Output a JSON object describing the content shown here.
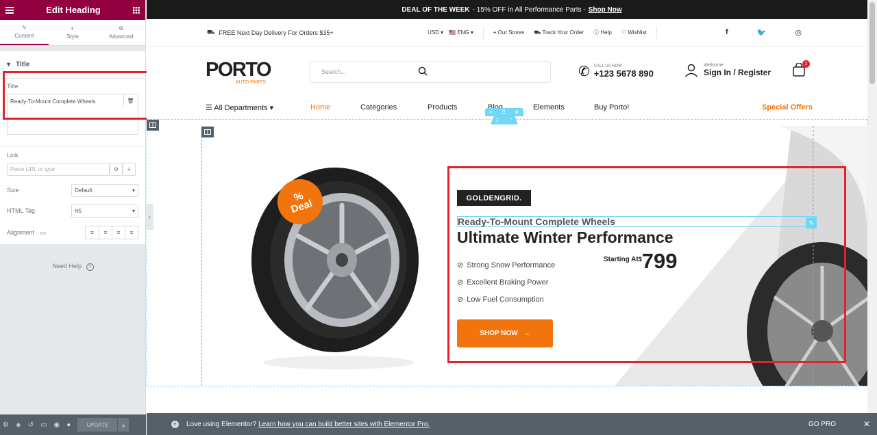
{
  "panel": {
    "title": "Edit Heading",
    "tabs": [
      {
        "label": "Content",
        "icon": "pencil-icon"
      },
      {
        "label": "Style",
        "icon": "contrast-icon"
      },
      {
        "label": "Advanced",
        "icon": "gear-icon"
      }
    ],
    "section_title": "Title",
    "title_field_label": "Title",
    "title_value": "Ready-To-Mount Complete Wheels",
    "link_label": "Link",
    "link_placeholder": "Paste URL or type",
    "size_label": "Size",
    "size_value": "Default",
    "html_tag_label": "HTML Tag",
    "html_tag_value": "H5",
    "alignment_label": "Alignment",
    "need_help": "Need Help",
    "update_label": "UPDATE"
  },
  "site": {
    "deal_bar": {
      "prefix": "DEAL OF THE WEEK",
      "text": " - 15% OFF in All Performance Parts - ",
      "link": "Shop Now"
    },
    "util": {
      "delivery": "FREE Next Day Delivery For Orders $35+",
      "currency": "USD",
      "language": "ENG",
      "our_stores": "Our Stores",
      "track_order": "Track Your Order",
      "help": "Help",
      "wishlist": "Wishlist"
    },
    "logo": {
      "brand": "PORTO",
      "sub": "AUTO PARTS"
    },
    "search_placeholder": "Search...",
    "call": {
      "small": "CALL US NOW",
      "big": "+123 5678 890"
    },
    "account": {
      "small": "Welcome",
      "big": "Sign In / Register"
    },
    "cart_count": "1",
    "nav": {
      "departments": "All Departments",
      "home": "Home",
      "categories": "Categories",
      "products": "Products",
      "blog": "Blog",
      "elements": "Elements",
      "buy": "Buy Porto!",
      "special": "Special Offers"
    },
    "banner": {
      "badge_top": "%",
      "badge_bottom": "Deal",
      "brand_logo": "GOLDENGRID.",
      "sub_heading": "Ready-To-Mount Complete Wheels",
      "heading": "Ultimate Winter Performance",
      "features": [
        "Strong Snow Performance",
        "Excellent Braking Power",
        "Low Fuel Consumption"
      ],
      "price_label": "Starting At",
      "price_currency": "$",
      "price_value": "799",
      "button": "SHOP NOW"
    }
  },
  "promo": {
    "message": "Love using Elementor? ",
    "link": "Learn how you can build better sites with Elementor Pro.",
    "gopro": "GO PRO"
  },
  "colors": {
    "accent": "#93003f",
    "orange": "#f2740c",
    "highlight": "#e8202c",
    "edit_blue": "#71d7f7"
  }
}
